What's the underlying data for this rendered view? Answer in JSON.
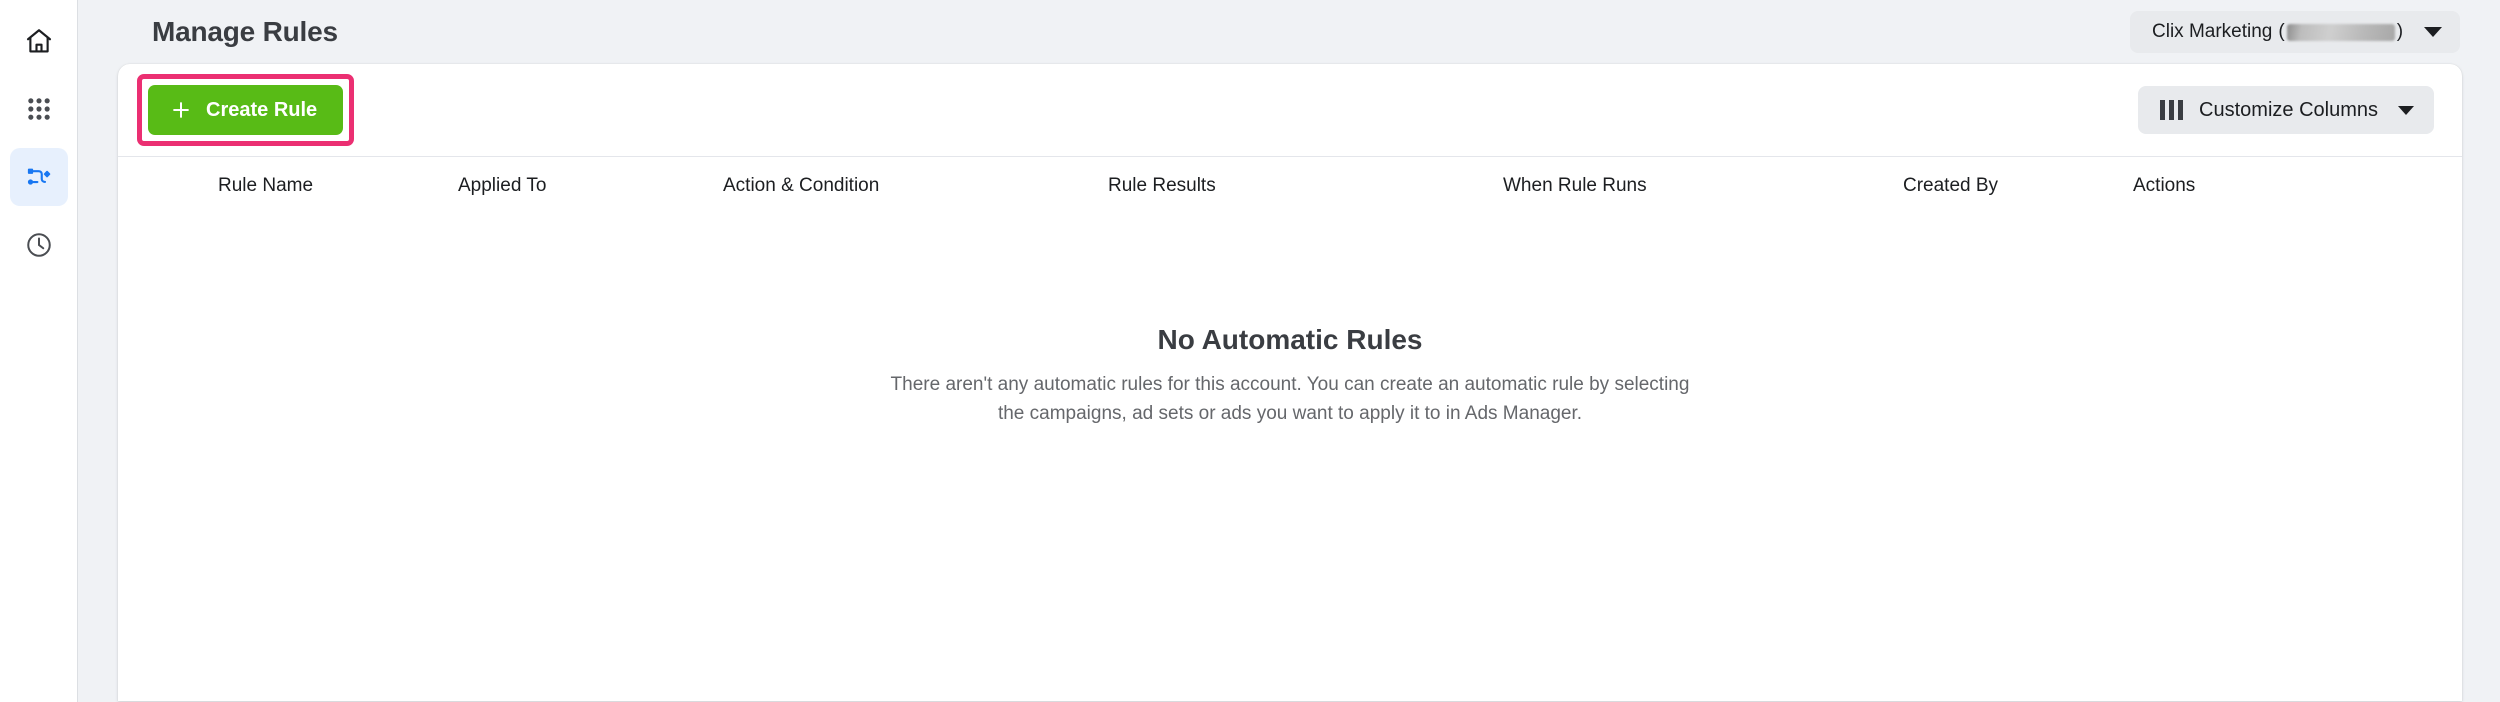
{
  "sidebar": {
    "items": [
      {
        "icon": "home-icon",
        "name": "home",
        "active": false
      },
      {
        "icon": "grid-apps-icon",
        "name": "all-tools",
        "active": false
      },
      {
        "icon": "automated-rules-icon",
        "name": "rules",
        "active": true
      },
      {
        "icon": "clock-history-icon",
        "name": "history",
        "active": false
      }
    ]
  },
  "header": {
    "title": "Manage Rules",
    "account": {
      "name": "Clix Marketing",
      "open_paren": "(",
      "close_paren": ")",
      "id_redacted": true,
      "caret_icon": "chevron-down-icon"
    }
  },
  "toolbar": {
    "create_rule_label": "Create Rule",
    "create_rule_icon": "plus-icon",
    "create_rule_highlighted": true,
    "highlight_color": "#eb2f72",
    "create_rule_color": "#58bb16",
    "customize_columns_label": "Customize Columns",
    "customize_columns_icon": "columns-icon",
    "customize_columns_caret": "chevron-down-icon"
  },
  "table": {
    "columns": [
      "Rule Name",
      "Applied To",
      "Action & Condition",
      "Rule Results",
      "When Rule Runs",
      "Created By",
      "Actions"
    ],
    "rows": []
  },
  "empty_state": {
    "title": "No Automatic Rules",
    "description": "There aren't any automatic rules for this account. You can create an automatic rule by selecting the campaigns, ad sets or ads you want to apply it to in Ads Manager."
  }
}
